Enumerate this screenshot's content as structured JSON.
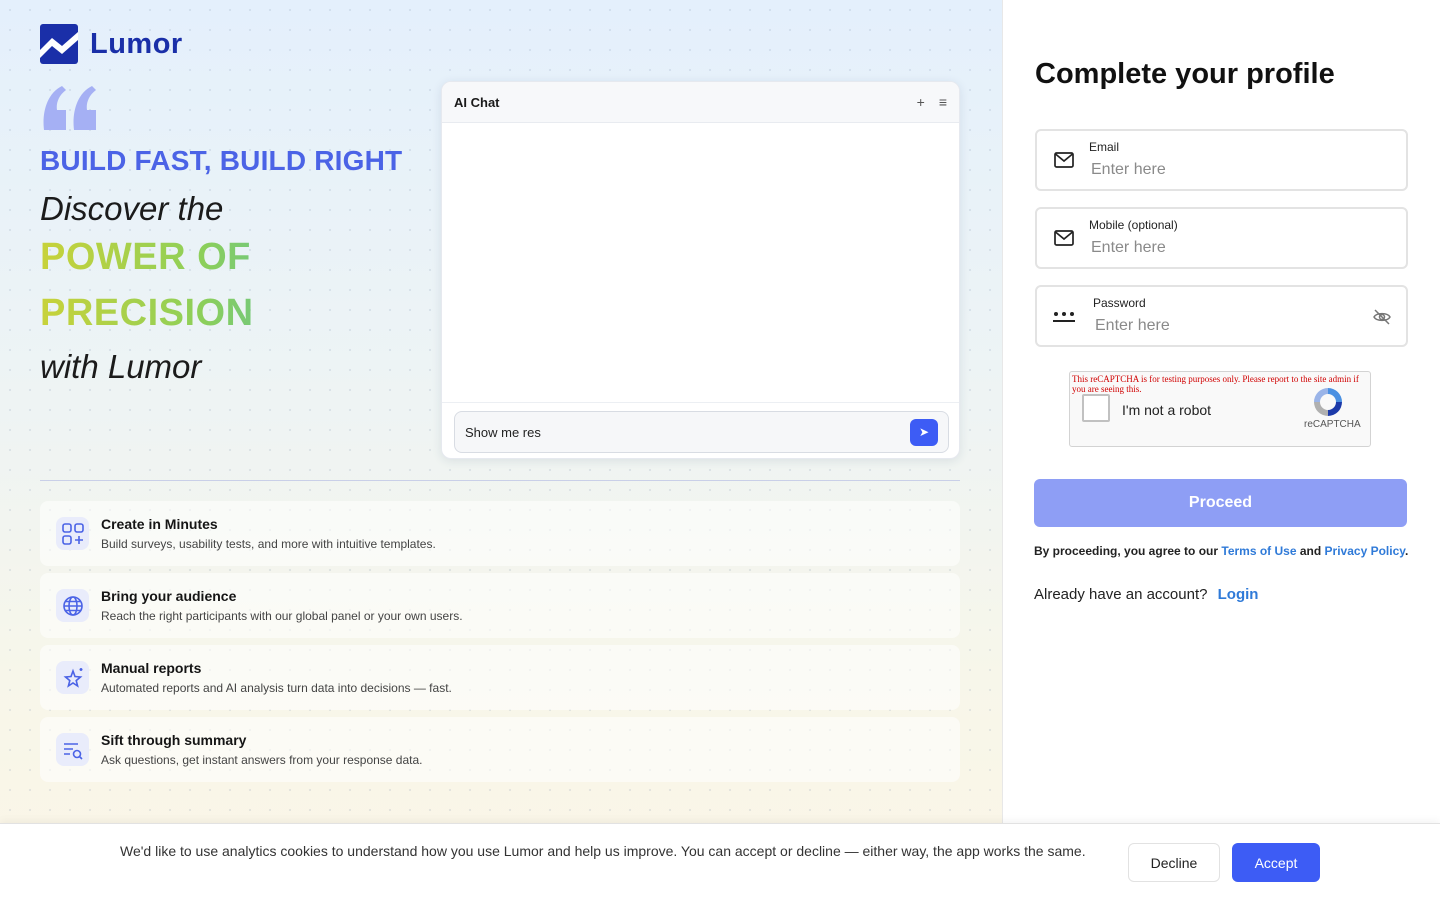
{
  "brand": {
    "name": "Lumor",
    "color": "#1a2fa8"
  },
  "hero": {
    "tagline": "BUILD FAST, BUILD RIGHT",
    "line1": "Discover the",
    "line2": "POWER OF",
    "line3": "PRECISION",
    "line4": "with Lumor"
  },
  "chat": {
    "title": "AI Chat",
    "input_value": "Show me res",
    "add_icon": "+",
    "menu_icon": "≡",
    "send_icon": "➤"
  },
  "features": [
    {
      "icon": "grid-plus-icon",
      "title": "Create in Minutes",
      "desc": "Build surveys, usability tests, and more with intuitive templates."
    },
    {
      "icon": "globe-icon",
      "title": "Bring your audience",
      "desc": "Reach the right participants with our global panel or your own users."
    },
    {
      "icon": "sparkle-star-icon",
      "title": "Manual reports",
      "desc": "Automated reports and AI analysis turn data into decisions — fast."
    },
    {
      "icon": "list-search-icon",
      "title": "Sift through summary",
      "desc": "Ask questions, get instant answers from your response data."
    }
  ],
  "form": {
    "title": "Complete your profile",
    "email": {
      "label": "Email",
      "placeholder": "Enter here",
      "value": ""
    },
    "mobile": {
      "label": "Mobile (optional)",
      "placeholder": "Enter here",
      "value": ""
    },
    "password": {
      "label": "Password",
      "placeholder": "Enter here",
      "value": ""
    },
    "captcha": {
      "warning": "This reCAPTCHA is for testing purposes only. Please report to the site admin if you are seeing this.",
      "label": "I'm not a robot",
      "brand": "reCAPTCHA"
    },
    "proceed_label": "Proceed",
    "terms_prefix": "By proceeding, you agree to our",
    "terms_link": "Terms of Use",
    "terms_and": "and",
    "privacy_link": "Privacy Policy",
    "terms_suffix": ".",
    "login_prompt": "Already have an account?",
    "login_link": "Login"
  },
  "cookie": {
    "text": "We'd like to use analytics cookies to understand how you use Lumor and help us improve. You can accept or decline — either way, the app works the same.",
    "decline_label": "Decline",
    "accept_label": "Accept"
  },
  "colors": {
    "accent": "#3d5cf5",
    "proceed_disabled": "#8e9ef5",
    "link": "#2f7ad8"
  }
}
